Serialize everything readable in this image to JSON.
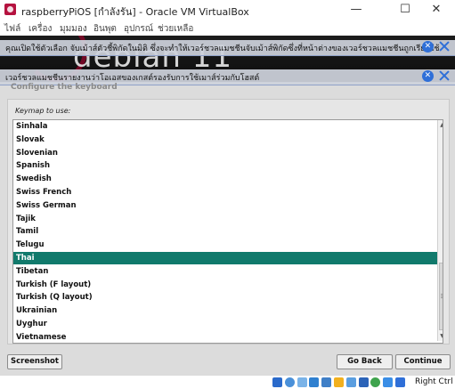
{
  "window": {
    "title": "raspberryPiOS [กำลังรัน] - Oracle VM VirtualBox",
    "minimize_glyph": "—",
    "maximize_glyph": "☐",
    "close_glyph": "✕"
  },
  "menu": [
    "ไฟล์",
    "เครื่อง",
    "มุมมอง",
    "อินพุต",
    "อุปกรณ์",
    "ช่วยเหลือ"
  ],
  "banner": {
    "logo_text": "debian 11"
  },
  "notifications": [
    {
      "text": "คุณเปิดใช้ตัวเลือก จับเม้าส์ตัวชี้พิกัดในมิติ ซึ่งจะทำให้เวอร์ชวลแมชชีนจับเม้าส์พิกัดซึ่งที่หน้าต่างของเวอร์ชวลแมชชีนถูกเรียกใช้"
    },
    {
      "text": "เวอร์ชวลแมชชีนรายงานว่าโอเอสของเกสต์รองรับการใช้เมาส์ร่วมกับโฮสต์"
    }
  ],
  "installer": {
    "page_heading": "Configure the keyboard",
    "keymap_label": "Keymap to use:",
    "items": [
      "Sinhala",
      "Slovak",
      "Slovenian",
      "Spanish",
      "Swedish",
      "Swiss French",
      "Swiss German",
      "Tajik",
      "Tamil",
      "Telugu",
      "Thai",
      "Tibetan",
      "Turkish (F layout)",
      "Turkish (Q layout)",
      "Ukrainian",
      "Uyghur",
      "Vietnamese"
    ],
    "selected_item": "Thai",
    "buttons": {
      "screenshot": "Screenshot",
      "go_back": "Go Back",
      "continue": "Continue"
    }
  },
  "statusbar": {
    "host_key": "Right Ctrl",
    "icons": [
      "hard-disk-icon",
      "optical-drive-icon",
      "audio-icon",
      "network-icon",
      "usb-icon",
      "shared-folders-icon",
      "display-icon",
      "recording-icon",
      "cpu-icon",
      "mouse-integration-icon",
      "keyboard-icon"
    ]
  },
  "colors": {
    "selection": "#117a6c",
    "notification_icon": "#2f6fd8",
    "app_icon": "#b5123f"
  }
}
